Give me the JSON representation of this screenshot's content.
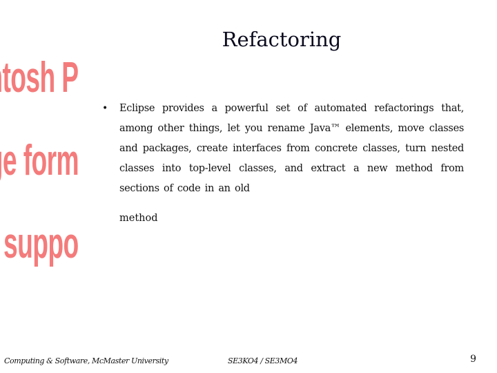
{
  "slide": {
    "title": "Refactoring",
    "placeholder_image": {
      "lines": [
        "acintosh P",
        "mage form",
        "not suppo"
      ],
      "color": "#f47b7b"
    },
    "bullets": [
      {
        "marker": "•",
        "text": "Eclipse provides a powerful set of automated refactorings that, among other things, let you rename Java™ elements, move classes and packages, create interfaces from concrete classes, turn nested classes into top-level classes, and extract a new method from sections of code in an old",
        "continuation": "method"
      }
    ],
    "footer": {
      "left": "Computing & Software, McMaster University",
      "center": "SE3KO4 / SE3MO4",
      "page_number": "9"
    }
  }
}
